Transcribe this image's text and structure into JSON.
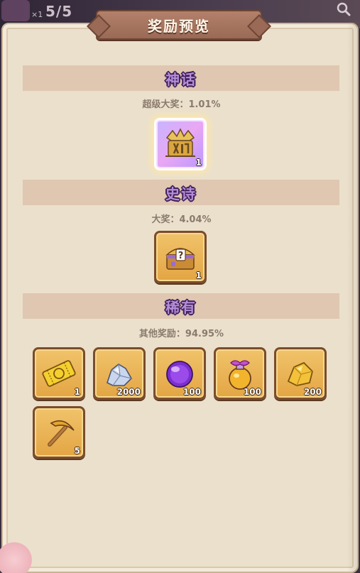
{
  "top_bar": {
    "counter": "5/5",
    "multiplier": "×1",
    "search_icon": "search-icon"
  },
  "panel": {
    "title": "奖励预览"
  },
  "sections": [
    {
      "title": "神话",
      "chance_label": "超级大奖：1.01%",
      "items": [
        {
          "icon": "mythic-chest-icon",
          "quantity": "1"
        }
      ]
    },
    {
      "title": "史诗",
      "chance_label": "大奖：4.04%",
      "items": [
        {
          "icon": "mystery-chest-icon",
          "quantity": "1"
        }
      ]
    },
    {
      "title": "稀有",
      "chance_label": "其他奖励：94.95%",
      "items": [
        {
          "icon": "gold-ticket-icon",
          "quantity": "1"
        },
        {
          "icon": "crystal-ore-icon",
          "quantity": "2000"
        },
        {
          "icon": "purple-orb-icon",
          "quantity": "100"
        },
        {
          "icon": "potion-flask-icon",
          "quantity": "100"
        },
        {
          "icon": "gold-ore-icon",
          "quantity": "200"
        },
        {
          "icon": "pickaxe-icon",
          "quantity": "5"
        }
      ]
    }
  ],
  "colors": {
    "panel_bg": "#ebe0cc",
    "section_bar": "#dfc7b2",
    "section_title": "#b58ed9",
    "tile": "#e3a544",
    "banner": "#9a6a56"
  }
}
